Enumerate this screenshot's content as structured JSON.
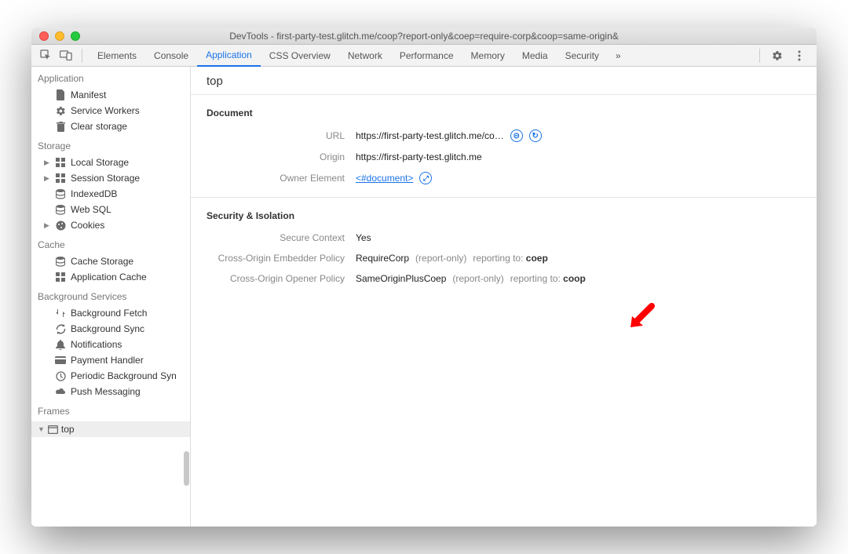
{
  "window_title": "DevTools - first-party-test.glitch.me/coop?report-only&coep=require-corp&coop=same-origin&",
  "tabs": [
    "Elements",
    "Console",
    "Application",
    "CSS Overview",
    "Network",
    "Performance",
    "Memory",
    "Media",
    "Security"
  ],
  "active_tab": "Application",
  "sidebar": {
    "application": {
      "header": "Application",
      "items": [
        "Manifest",
        "Service Workers",
        "Clear storage"
      ]
    },
    "storage": {
      "header": "Storage",
      "items": [
        "Local Storage",
        "Session Storage",
        "IndexedDB",
        "Web SQL",
        "Cookies"
      ]
    },
    "cache": {
      "header": "Cache",
      "items": [
        "Cache Storage",
        "Application Cache"
      ]
    },
    "background": {
      "header": "Background Services",
      "items": [
        "Background Fetch",
        "Background Sync",
        "Notifications",
        "Payment Handler",
        "Periodic Background Syn",
        "Push Messaging"
      ]
    },
    "frames": {
      "header": "Frames",
      "items": [
        "top"
      ]
    }
  },
  "main": {
    "title": "top",
    "document": {
      "header": "Document",
      "url_label": "URL",
      "url": "https://first-party-test.glitch.me/co…",
      "origin_label": "Origin",
      "origin": "https://first-party-test.glitch.me",
      "owner_label": "Owner Element",
      "owner": "<#document>"
    },
    "security": {
      "header": "Security & Isolation",
      "secure_label": "Secure Context",
      "secure": "Yes",
      "coep_label": "Cross-Origin Embedder Policy",
      "coep_value": "RequireCorp",
      "coep_mode": "(report-only)",
      "coep_report_lbl": "reporting to:",
      "coep_report": "coep",
      "coop_label": "Cross-Origin Opener Policy",
      "coop_value": "SameOriginPlusCoep",
      "coop_mode": "(report-only)",
      "coop_report_lbl": "reporting to:",
      "coop_report": "coop"
    }
  }
}
